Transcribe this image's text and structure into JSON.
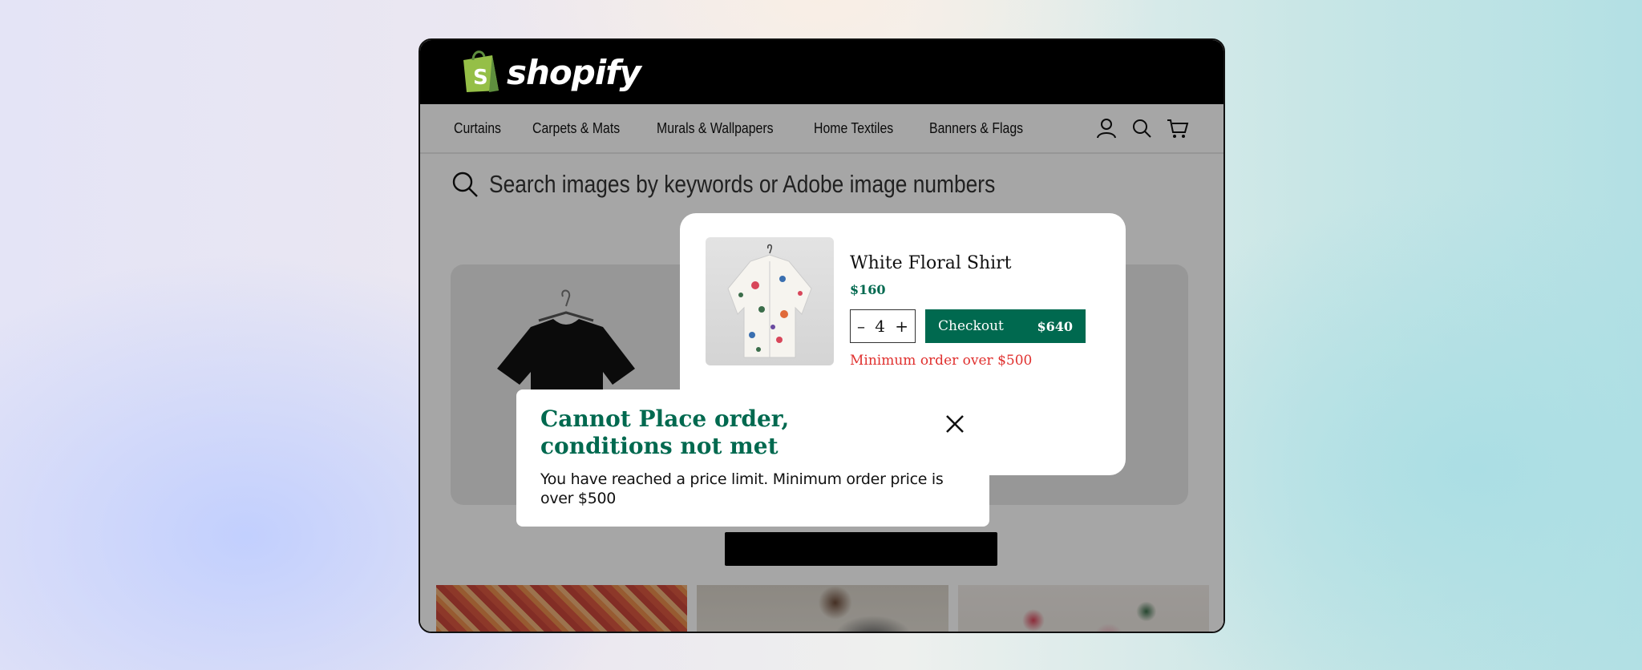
{
  "app": {
    "brand": "shopify"
  },
  "nav": {
    "links": [
      "Curtains",
      "Carpets & Mats",
      "Murals & Wallpapers",
      "Home Textiles",
      "Banners & Flags"
    ],
    "icons": [
      "user-icon",
      "search-icon",
      "cart-icon"
    ]
  },
  "search": {
    "placeholder": "Search images by keywords or Adobe image numbers"
  },
  "cart": {
    "product_name": "White Floral Shirt",
    "price": "$160",
    "quantity": "4",
    "decrement": "–",
    "increment": "+",
    "checkout_label": "Checkout",
    "checkout_total": "$640",
    "warning": "Minimum order over $500"
  },
  "toast": {
    "title": "Cannot Place order, conditions not met",
    "message": "You have reached a price limit. Minimum order price is over $500"
  },
  "colors": {
    "accent": "#00694f",
    "error": "#e0302e",
    "topbar": "#000000",
    "logo_bag": "#95bf47"
  }
}
